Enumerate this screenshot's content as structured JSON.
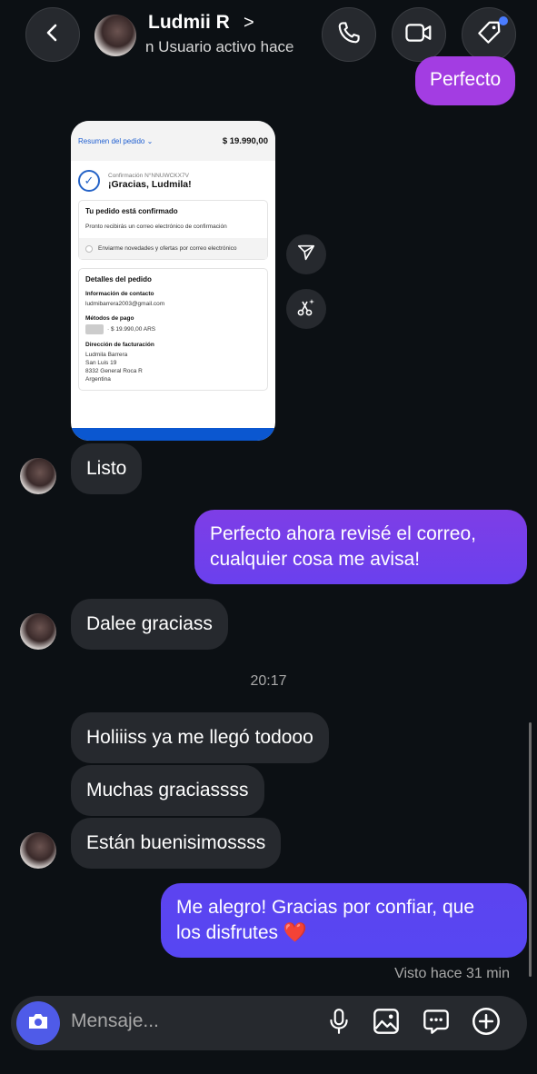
{
  "header": {
    "name": "Ludmii R",
    "chevron": ">",
    "status": "n   Usuario activo hace"
  },
  "colors": {
    "background": "#0c1014",
    "received_bubble": "#26292e",
    "sent_gradient_top": "#a63ce0",
    "sent_gradient_bottom": "#5a44f0",
    "accent_blue": "#4a7cff"
  },
  "icons": {
    "back": "chevron-left-icon",
    "call": "phone-icon",
    "video": "video-camera-icon",
    "tag": "tag-icon",
    "forward": "send-paper-plane-icon",
    "cut": "scissors-sparkle-icon",
    "camera": "camera-icon",
    "mic": "microphone-icon",
    "gallery": "image-icon",
    "sticker": "chat-bubble-icon",
    "plus": "plus-circle-icon"
  },
  "receipt": {
    "summary_link": "Resumen del pedido",
    "total": "$ 19.990,00",
    "confirmation_number": "Confirmación N°NNUWCKX7V",
    "thanks": "¡Gracias, Ludmila!",
    "confirmed_heading": "Tu pedido está confirmado",
    "confirmed_text": "Pronto recibirás un correo electrónico de confirmación",
    "newsletter_option": "Enviarme novedades y ofertas por correo electrónico",
    "details_heading": "Detalles del pedido",
    "contact_label": "Información de contacto",
    "contact_email": "ludmibarrera2003@gmail.com",
    "payment_label": "Métodos de pago",
    "payment_value": "· $ 19.990,00 ARS",
    "billing_label": "Dirección de facturación",
    "billing_name": "Ludmila Barrera",
    "billing_street": "San Luis 19",
    "billing_city": "8332 General Roca R",
    "billing_country": "Argentina"
  },
  "messages": {
    "m0": "Perfecto",
    "m1": "Listo",
    "m2_line1": "Perfecto ahora revisé el correo,",
    "m2_line2": "cualquier cosa me avisa!",
    "m3": "Dalee graciass",
    "time_separator": "20:17",
    "m4": "Holiiiss ya me llegó todooo",
    "m5": "Muchas graciassss",
    "m6": "Están buenisimossss",
    "m7_line1": "Me alegro! Gracias por confiar, que",
    "m7_line2": "los disfrutes ❤️",
    "seen": "Visto hace 31 min"
  },
  "composer": {
    "placeholder": "Mensaje..."
  }
}
